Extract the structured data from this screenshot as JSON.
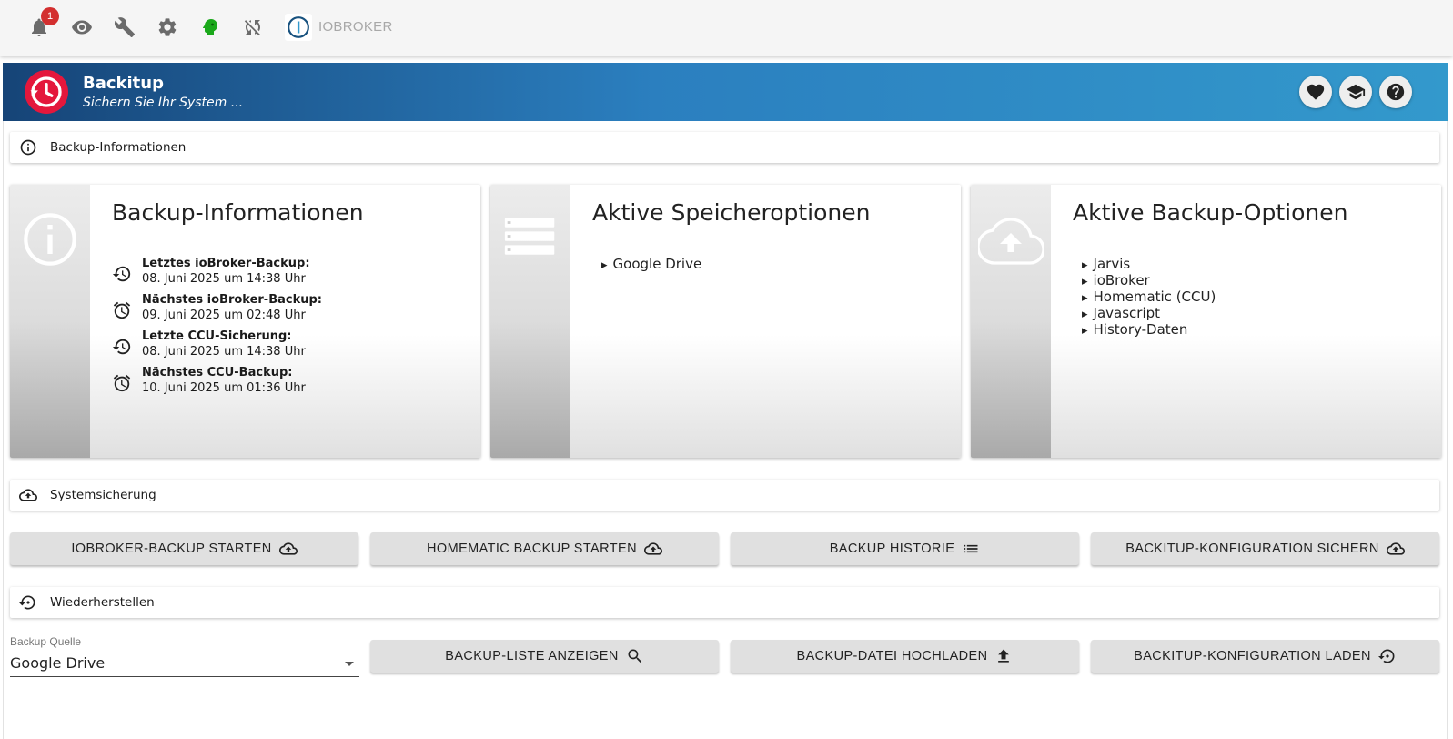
{
  "toolbar": {
    "notification_count": "1",
    "brand": "IOBROKER",
    "accent_green": "#1aa81a"
  },
  "header": {
    "title": "Backitup",
    "subtitle": "Sichern Sie Ihr System ...",
    "gradient": [
      "#164477",
      "#3399cc"
    ],
    "logo_color": "#e4173c"
  },
  "sections": {
    "info": "Backup-Informationen",
    "backup": "Systemsicherung",
    "restore": "Wiederherstellen"
  },
  "cards": {
    "info": {
      "title": "Backup-Informationen",
      "rows": [
        {
          "label": "Letztes ioBroker-Backup:",
          "value": "08. Juni 2025 um 14:38 Uhr",
          "icon": "history-icon"
        },
        {
          "label": "Nächstes ioBroker-Backup:",
          "value": "09. Juni 2025 um 02:48 Uhr",
          "icon": "alarm-icon"
        },
        {
          "label": "Letzte CCU-Sicherung:",
          "value": "08. Juni 2025 um 14:38 Uhr",
          "icon": "history-icon"
        },
        {
          "label": "Nächstes CCU-Backup:",
          "value": "10. Juni 2025 um 01:36 Uhr",
          "icon": "alarm-icon"
        }
      ]
    },
    "storage": {
      "title": "Aktive Speicheroptionen",
      "items": [
        "Google Drive"
      ]
    },
    "options": {
      "title": "Aktive Backup-Optionen",
      "items": [
        "Jarvis",
        "ioBroker",
        "Homematic (CCU)",
        "Javascript",
        "History-Daten"
      ]
    }
  },
  "backup_buttons": [
    {
      "label": "IOBROKER-BACKUP STARTEN",
      "icon": "cloud-upload-icon"
    },
    {
      "label": "HOMEMATIC BACKUP STARTEN",
      "icon": "cloud-upload-icon"
    },
    {
      "label": "BACKUP HISTORIE",
      "icon": "list-icon"
    },
    {
      "label": "BACKITUP-KONFIGURATION SICHERN",
      "icon": "cloud-upload-icon"
    }
  ],
  "restore": {
    "source_label": "Backup Quelle",
    "source_value": "Google Drive",
    "buttons": [
      {
        "label": "BACKUP-LISTE ANZEIGEN",
        "icon": "search-icon"
      },
      {
        "label": "BACKUP-DATEI HOCHLADEN",
        "icon": "upload-icon"
      },
      {
        "label": "BACKITUP-KONFIGURATION LADEN",
        "icon": "restore-icon"
      }
    ]
  }
}
